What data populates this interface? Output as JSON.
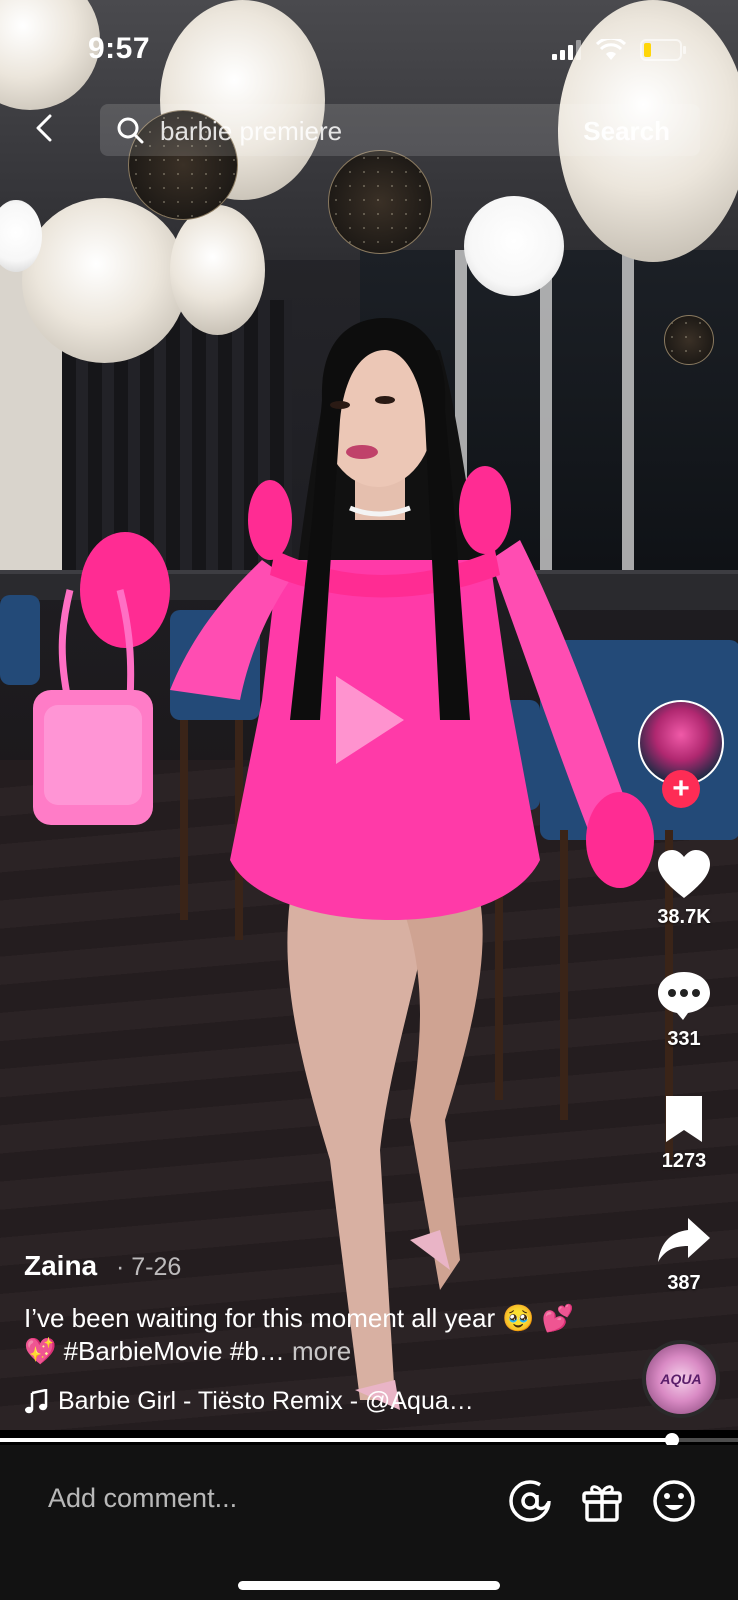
{
  "status_bar": {
    "time": "9:57"
  },
  "search": {
    "query": "barbie premiere",
    "button_label": "Search"
  },
  "video": {
    "author": "Zaina",
    "date": "· 7-26",
    "caption": "I’ve been waiting for this moment all year 🥹 💕 💖 #BarbieMovie #b…",
    "more_label": "more",
    "music": "Barbie Girl - Tiësto Remix - @Aqua…",
    "progress": 0.91
  },
  "actions": {
    "likes": "38.7K",
    "comments": "331",
    "saves": "1273",
    "shares": "387",
    "disc_label": "AQUA"
  },
  "comment_bar": {
    "placeholder": "Add comment..."
  },
  "colors": {
    "accent": "#fe2c55",
    "bar_bg": "#121212"
  }
}
